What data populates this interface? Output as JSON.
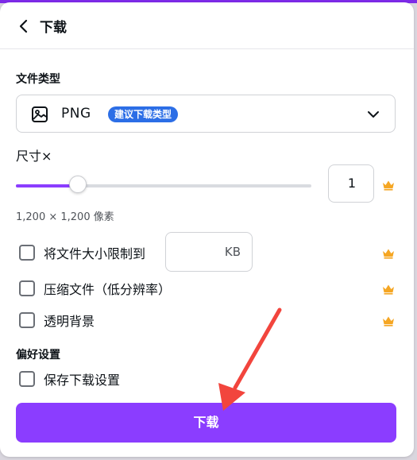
{
  "header": {
    "title": "下载"
  },
  "file_type_section": {
    "label": "文件类型",
    "selected": "PNG",
    "badge": "建议下载类型",
    "icon": "image-icon"
  },
  "size_section": {
    "label": "尺寸×",
    "scale_value": "1",
    "slider_fraction": 0.21,
    "dimensions": "1,200 × 1,200 像素"
  },
  "options": {
    "limit_size_label": "将文件大小限制到",
    "kb_unit": "KB",
    "compress_label": "压缩文件（低分辨率）",
    "transparent_label": "透明背景"
  },
  "preferences": {
    "label": "偏好设置",
    "save_settings_label": "保存下载设置"
  },
  "download_button": {
    "label": "下载"
  },
  "colors": {
    "accent": "#8b3dff",
    "badge": "#2c6ee6",
    "crown": "#f5a623",
    "annotation_arrow": "#f2453d"
  }
}
